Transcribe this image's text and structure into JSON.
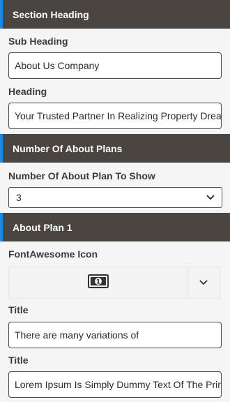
{
  "sections": {
    "section_heading": "Section Heading",
    "number_of_about_plans": "Number Of About Plans",
    "about_plan_1": "About Plan 1"
  },
  "fields": {
    "sub_heading": {
      "label": "Sub Heading",
      "value": "About Us Company"
    },
    "heading": {
      "label": "Heading",
      "value": "Your Trusted Partner In Realizing Property Dreams"
    },
    "plans_to_show": {
      "label": "Number Of About Plan To Show",
      "selected": "3"
    },
    "fontawesome_icon": {
      "label": "FontAwesome Icon",
      "icon": "money-bill-icon"
    },
    "plan_title": {
      "label": "Title",
      "value": "There are many variations of"
    },
    "plan_title_2": {
      "label": "Title",
      "value": "Lorem Ipsum Is Simply Dummy Text Of The Printing"
    }
  },
  "colors": {
    "header_bg": "#4a4541",
    "accent": "#1e88e5",
    "page_bg": "#f5f5f5"
  }
}
